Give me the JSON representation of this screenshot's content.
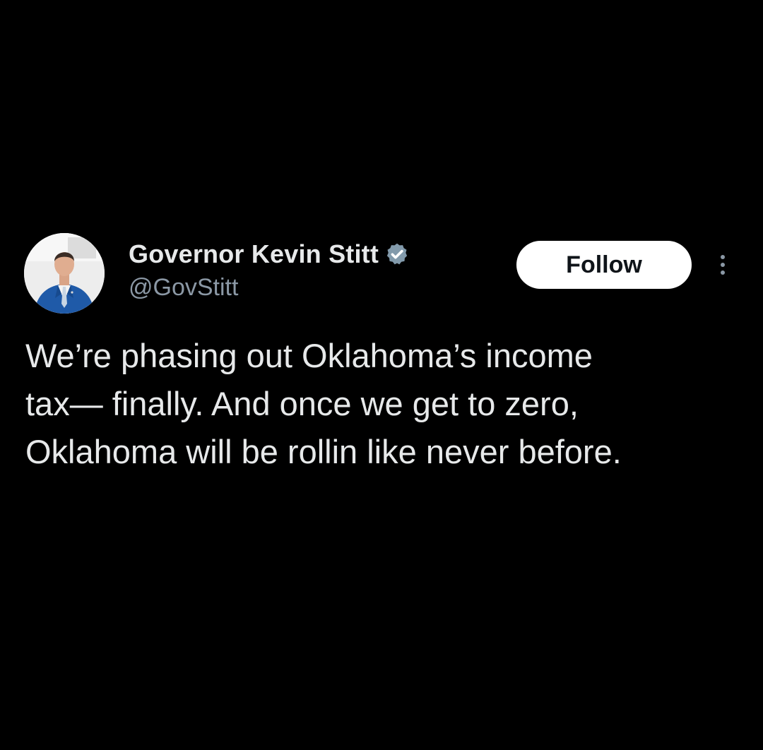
{
  "author": {
    "display_name": "Governor Kevin Stitt",
    "handle": "@GovStitt",
    "verified_icon": "verified-badge-icon",
    "avatar": "avatar-photo"
  },
  "actions": {
    "follow_label": "Follow",
    "more_icon": "more-options-icon"
  },
  "tweet": {
    "lines": [
      "We’re phasing out Oklahoma’s income",
      "tax— finally. And once we get to zero,",
      "Oklahoma will be rollin like never before."
    ]
  },
  "colors": {
    "background": "#000000",
    "text": "#e7e9ea",
    "secondary_text": "#8b98a5",
    "follow_bg": "#ffffff",
    "follow_text": "#0f1419"
  }
}
